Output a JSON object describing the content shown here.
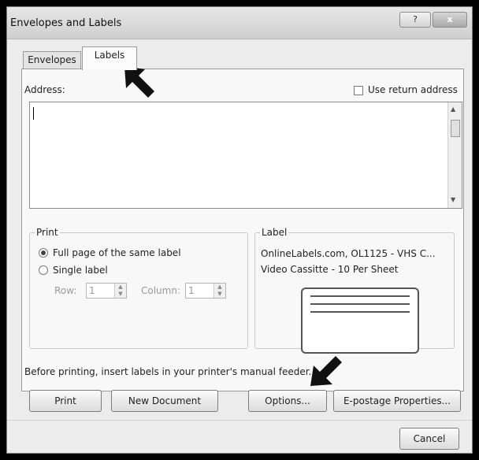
{
  "window": {
    "title": "Envelopes and Labels",
    "help_label": "?",
    "close_label": "x"
  },
  "tabs": [
    {
      "label": "Envelopes"
    },
    {
      "label": "Labels"
    }
  ],
  "address": {
    "label": "Address:",
    "value": "",
    "use_return_label": "Use return address"
  },
  "print_group": {
    "title": "Print",
    "full_page_label": "Full page of the same label",
    "single_label_label": "Single label",
    "row_label": "Row:",
    "row_value": "1",
    "column_label": "Column:",
    "column_value": "1"
  },
  "label_group": {
    "title": "Label",
    "line1": "OnlineLabels.com, OL1125 - VHS C...",
    "line2": "Video Cassitte - 10 Per Sheet"
  },
  "notice": "Before printing, insert labels in your printer's manual feeder.",
  "buttons": {
    "print": "Print",
    "new_document": "New Document",
    "options": "Options...",
    "epostage": "E-postage Properties...",
    "cancel": "Cancel"
  }
}
